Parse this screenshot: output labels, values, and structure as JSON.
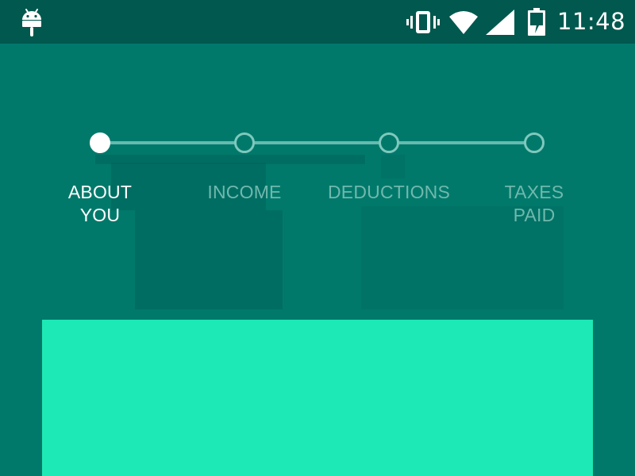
{
  "status_bar": {
    "time": "11:48",
    "icons": [
      "android-icon",
      "vibrate-icon",
      "wifi-icon",
      "signal-icon",
      "battery-charging-icon"
    ]
  },
  "stepper": {
    "steps": [
      {
        "label": "ABOUT\nYOU",
        "state": "active"
      },
      {
        "label": "INCOME",
        "state": "inactive"
      },
      {
        "label": "DEDUCTIONS",
        "state": "inactive"
      },
      {
        "label": "TAXES\nPAID",
        "state": "inactive"
      }
    ]
  },
  "colors": {
    "background": "#00796b",
    "status_bar": "#00584e",
    "card": "#1de9b6",
    "active": "#ffffff",
    "inactive": "#70b8ad"
  }
}
